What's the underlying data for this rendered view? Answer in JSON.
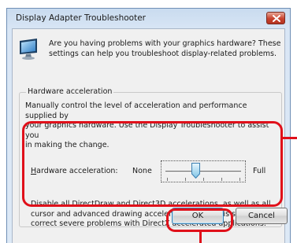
{
  "window": {
    "title": "Display Adapter Troubleshooter",
    "close_icon": "close-icon"
  },
  "intro": {
    "icon": "monitor-icon",
    "line1": "Are you having problems with your graphics hardware? These",
    "line2": "settings can help you troubleshoot display-related problems."
  },
  "group": {
    "legend": "Hardware acceleration",
    "desc_line1": "Manually control the level of acceleration and performance supplied by",
    "desc_line2": "your graphics hardware. Use the Display Troubleshooter to assist you",
    "desc_line3": "in making the change."
  },
  "slider": {
    "label_access_key": "H",
    "label_rest": "ardware acceleration:",
    "min_label": "None",
    "max_label": "Full",
    "position": 0.4
  },
  "note": {
    "line1": "Disable all DirectDraw and Direct3D accelerations, as well as all",
    "line2": "cursor and advanced drawing accelerations. Use this setting to",
    "line3": "correct severe problems with DirectX accelerated applications."
  },
  "buttons": {
    "ok": "OK",
    "cancel": "Cancel"
  },
  "colors": {
    "highlight": "#e0101a",
    "title_gradient": "#c9dbef"
  }
}
